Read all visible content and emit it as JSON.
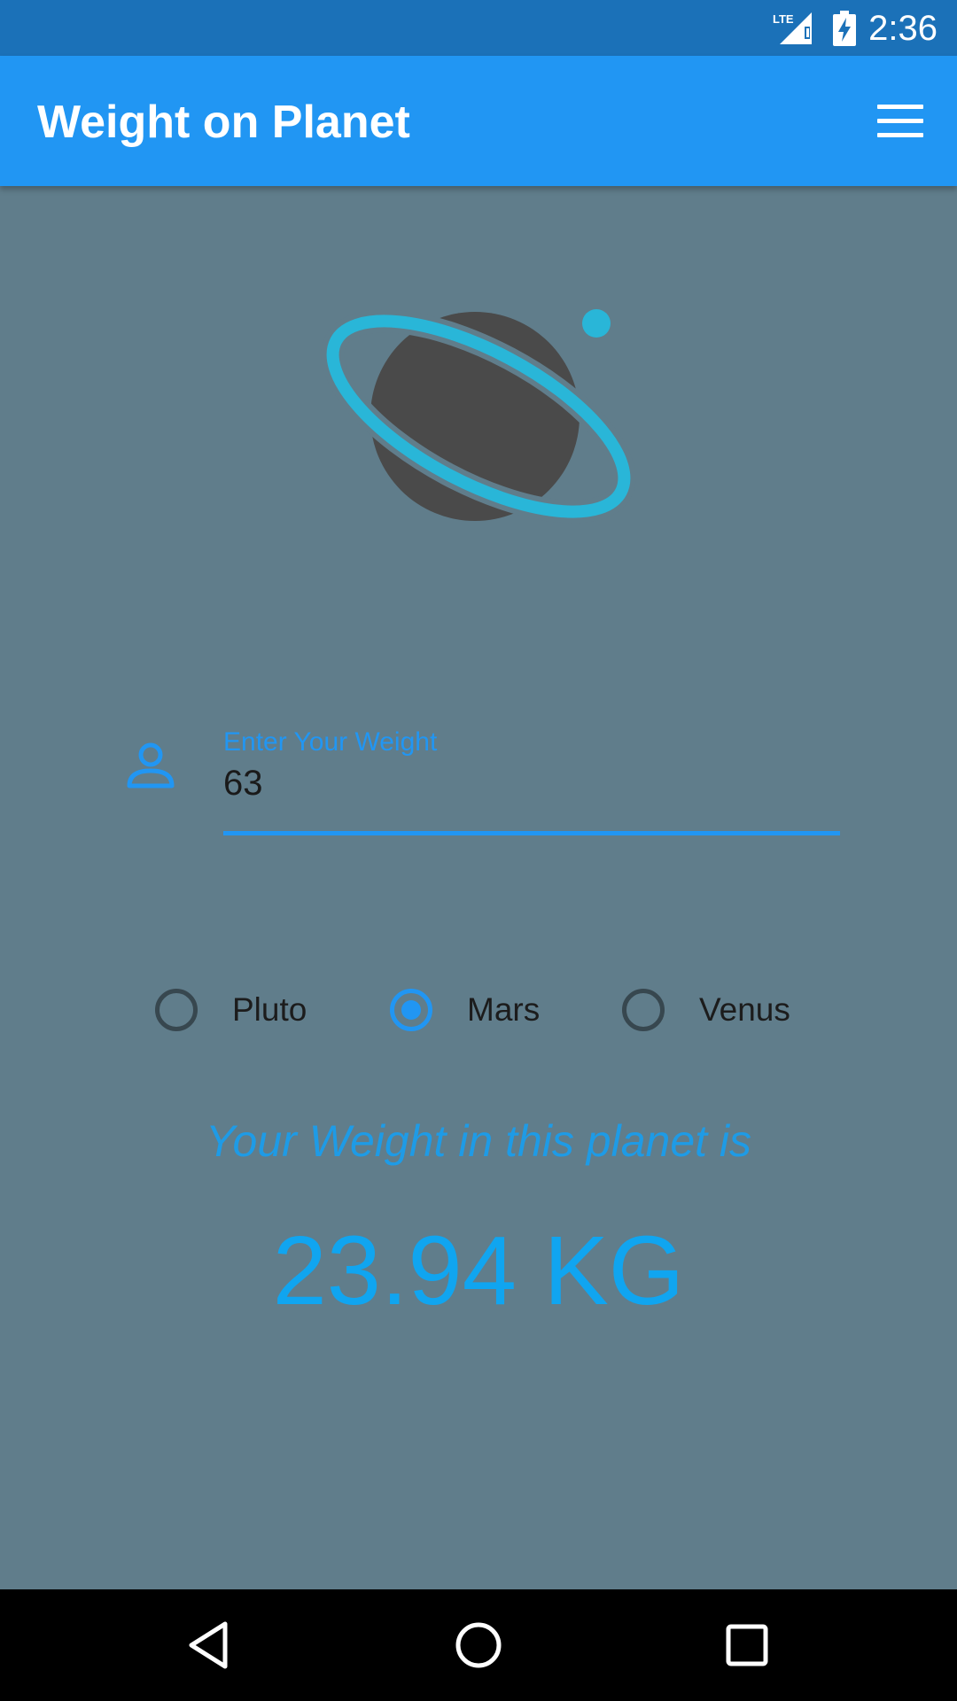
{
  "status_bar": {
    "time": "2:36",
    "network_label": "LTE",
    "icons": [
      "signal-icon",
      "battery-charging-icon"
    ]
  },
  "app_bar": {
    "title": "Weight on Planet",
    "menu_icon": "hamburger-menu-icon"
  },
  "colors": {
    "primary": "#2196f3",
    "status_bar": "#1b71b8",
    "background": "#607d8b",
    "planet_body": "#4a4a4a",
    "planet_ring": "#29b6d8",
    "result_text": "#10a5f0"
  },
  "weight_input": {
    "label": "Enter Your Weight",
    "value": "63",
    "icon": "person-icon"
  },
  "planets": {
    "options": [
      {
        "label": "Pluto",
        "selected": false
      },
      {
        "label": "Mars",
        "selected": true
      },
      {
        "label": "Venus",
        "selected": false
      }
    ]
  },
  "result": {
    "caption": "Your Weight in this planet is",
    "value": "23.94 KG"
  },
  "nav_bar": {
    "icons": [
      "back-triangle-icon",
      "home-circle-icon",
      "recents-square-icon"
    ]
  }
}
